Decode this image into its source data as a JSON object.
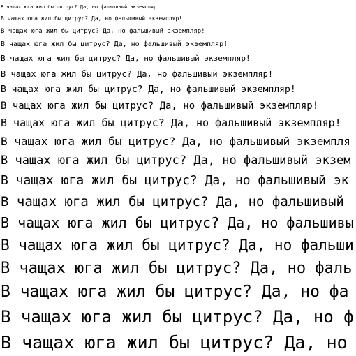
{
  "sample_text": "В чащах юга жил бы цитрус? Да, но фальшивый экземпляр!",
  "text_color": "#000000",
  "background_color": "#ffffff"
}
